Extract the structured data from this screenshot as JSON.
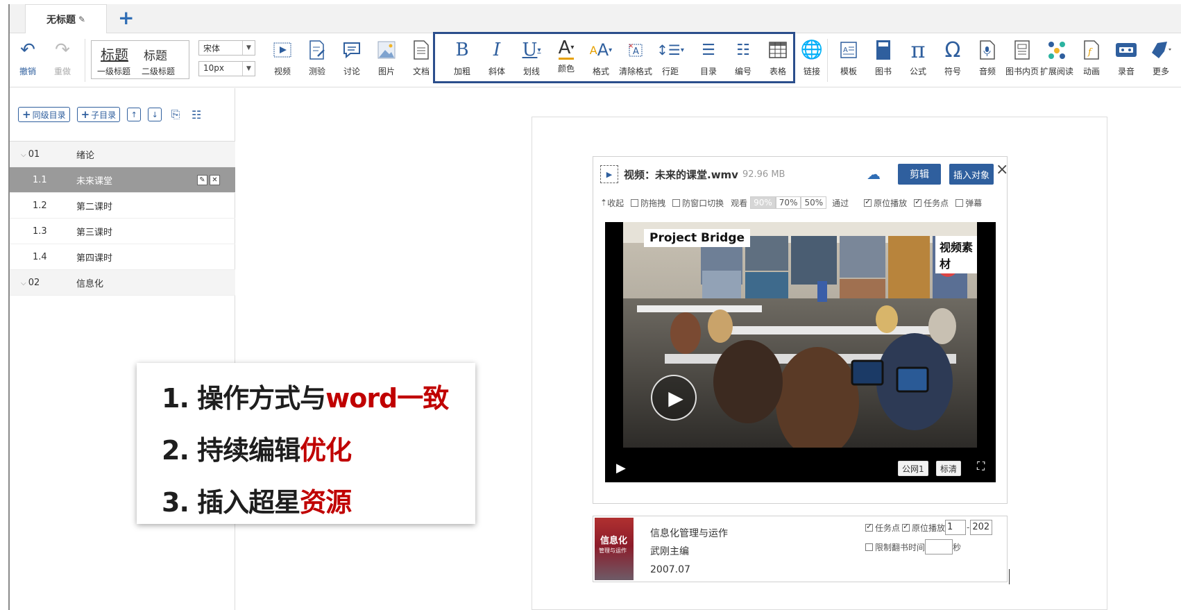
{
  "tabs": {
    "doc_title": "无标题",
    "add_label": "+"
  },
  "toolbar": {
    "undo": "撤销",
    "redo": "重做",
    "heading1": "标题",
    "heading2": "标题",
    "heading1_sub": "一级标题",
    "heading2_sub": "二级标题",
    "font_family": "宋体",
    "font_size": "10px",
    "tools": [
      {
        "label": "视频",
        "icon": "video-icon"
      },
      {
        "label": "测验",
        "icon": "quiz-icon"
      },
      {
        "label": "讨论",
        "icon": "discussion-icon"
      },
      {
        "label": "图片",
        "icon": "image-icon"
      },
      {
        "label": "文档",
        "icon": "document-icon"
      },
      {
        "label": "加粗",
        "icon": "bold-icon"
      },
      {
        "label": "斜体",
        "icon": "italic-icon"
      },
      {
        "label": "划线",
        "icon": "underline-icon"
      },
      {
        "label": "颜色",
        "icon": "font-color-icon"
      },
      {
        "label": "格式",
        "icon": "font-format-icon"
      },
      {
        "label": "清除格式",
        "icon": "clear-format-icon"
      },
      {
        "label": "行距",
        "icon": "line-spacing-icon"
      },
      {
        "label": "目录",
        "icon": "bullet-list-icon"
      },
      {
        "label": "编号",
        "icon": "numbered-list-icon"
      },
      {
        "label": "表格",
        "icon": "table-icon"
      },
      {
        "label": "链接",
        "icon": "link-icon"
      },
      {
        "label": "模板",
        "icon": "template-icon"
      },
      {
        "label": "图书",
        "icon": "book-icon"
      },
      {
        "label": "公式",
        "icon": "formula-icon"
      },
      {
        "label": "符号",
        "icon": "symbol-icon"
      },
      {
        "label": "音频",
        "icon": "audio-icon"
      },
      {
        "label": "图书内页",
        "icon": "book-page-icon"
      },
      {
        "label": "扩展阅读",
        "icon": "extended-reading-icon"
      },
      {
        "label": "动画",
        "icon": "animation-icon"
      },
      {
        "label": "录音",
        "icon": "recording-icon"
      },
      {
        "label": "更多",
        "icon": "more-icon"
      }
    ]
  },
  "sidebar": {
    "add_sibling": "同级目录",
    "add_child": "子目录",
    "items": [
      {
        "num": "01",
        "title": "绪论",
        "type": "chapter"
      },
      {
        "num": "1.1",
        "title": "未来课堂",
        "type": "active"
      },
      {
        "num": "1.2",
        "title": "第二课时",
        "type": "section"
      },
      {
        "num": "1.3",
        "title": "第三课时",
        "type": "section"
      },
      {
        "num": "1.4",
        "title": "第四课时",
        "type": "section"
      },
      {
        "num": "02",
        "title": "信息化",
        "type": "chapter"
      }
    ]
  },
  "callout": {
    "line1_prefix": "1. 操作方式与",
    "line1_red": "word一致",
    "line2_prefix": "2. 持续编辑",
    "line2_red": "优化",
    "line3_prefix": "3. 插入超星",
    "line3_red": "资源"
  },
  "video": {
    "title": "视频：未来的课堂.wmv",
    "size": "92.96 MB",
    "edit_btn": "剪辑",
    "insert_btn": "插入对象",
    "close": "×",
    "opts": {
      "collapse": "收起",
      "anti_drag": "防拖拽",
      "anti_switch": "防窗口切换",
      "watch": "观看",
      "p90": "90%",
      "p70": "70%",
      "p50": "50%",
      "pass": "通过",
      "inplace": "原位播放",
      "task_point": "任务点",
      "danmaku": "弹幕"
    },
    "overlay_left": "Project Bridge",
    "overlay_right": "视频素材",
    "network": "公网1",
    "quality": "标清"
  },
  "book": {
    "cover_title": "信息化",
    "cover_sub": "管理与运作",
    "title": "信息化管理与运作",
    "author": "武刚主编",
    "date": "2007.07",
    "task_point": "任务点",
    "inplace": "原位播放",
    "page_from": "1",
    "page_to": "202",
    "limit_time": "限制翻书时间",
    "sec": "秒"
  },
  "colors": {
    "accent": "#2f5f9e",
    "highlight_red": "#c00000",
    "frame_blue": "#2b4e8c"
  }
}
